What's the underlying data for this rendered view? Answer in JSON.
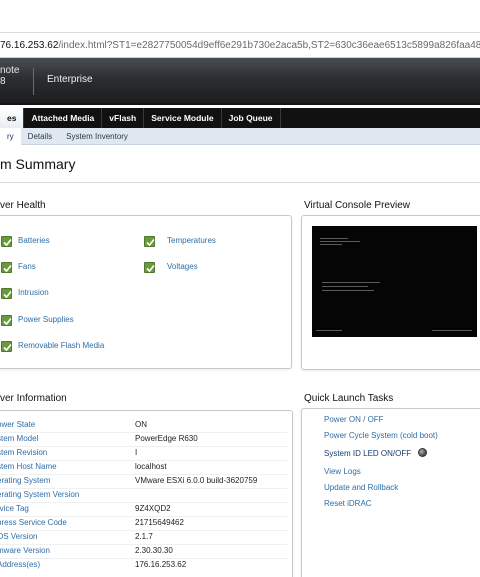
{
  "browser": {
    "url_host": "76.16.253.62",
    "url_path": "/index.html?ST1=e2827750054d9eff6e291b730e2aca5b,ST2=630c36eae6513c5899a826faa4821985"
  },
  "header": {
    "brand_line1": "note",
    "brand_line2": "8",
    "edition": "Enterprise"
  },
  "tabs": [
    {
      "label": "es",
      "active": true
    },
    {
      "label": "Attached Media"
    },
    {
      "label": "vFlash"
    },
    {
      "label": "Service Module"
    },
    {
      "label": "Job Queue"
    }
  ],
  "subtabs": [
    {
      "label": "ry",
      "active": true
    },
    {
      "label": "Details"
    },
    {
      "label": "System Inventory"
    }
  ],
  "page_title": "m Summary",
  "server_health": {
    "title": "ver Health",
    "items": [
      {
        "label": "Batteries",
        "status": "ok"
      },
      {
        "label": "Temperatures",
        "status": "ok"
      },
      {
        "label": "Fans",
        "status": "ok"
      },
      {
        "label": "Voltages",
        "status": "ok"
      },
      {
        "label": "Intrusion",
        "status": "ok"
      },
      {
        "label": "Power Supplies",
        "status": "ok"
      },
      {
        "label": "Removable Flash Media",
        "status": "ok"
      }
    ]
  },
  "console_preview": {
    "title": "Virtual Console Preview"
  },
  "server_information": {
    "title": "ver Information",
    "rows": [
      {
        "label": "ower State",
        "value": "ON"
      },
      {
        "label": "stem Model",
        "value": "PowerEdge R630"
      },
      {
        "label": "stem Revision",
        "value": "I"
      },
      {
        "label": "stem Host Name",
        "value": "localhost"
      },
      {
        "label": "erating System",
        "value": "VMware ESXi 6.0.0 build-3620759"
      },
      {
        "label": "erating System Version",
        "value": ""
      },
      {
        "label": "rvice Tag",
        "value": "9Z4XQD2"
      },
      {
        "label": "press Service Code",
        "value": "21715649462"
      },
      {
        "label": "OS Version",
        "value": "2.1.7"
      },
      {
        "label": "mware Version",
        "value": "2.30.30.30"
      },
      {
        "label": "Address(es)",
        "value": "176.16.253.62"
      }
    ]
  },
  "quick_launch": {
    "title": "Quick Launch Tasks",
    "links": [
      {
        "label": "Power ON / OFF"
      },
      {
        "label": "Power Cycle System (cold boot)"
      },
      {
        "label": "System ID LED ON/OFF"
      },
      {
        "label": "View Logs"
      },
      {
        "label": "Update and Rollback"
      },
      {
        "label": "Reset iDRAC"
      }
    ],
    "led_icon": "led-indicator-icon"
  },
  "colors": {
    "link": "#2f6ea6",
    "ok_green": "#6b9a3c",
    "header_dark": "#1c1d1f",
    "subtab_bg": "#dfe8f1"
  }
}
